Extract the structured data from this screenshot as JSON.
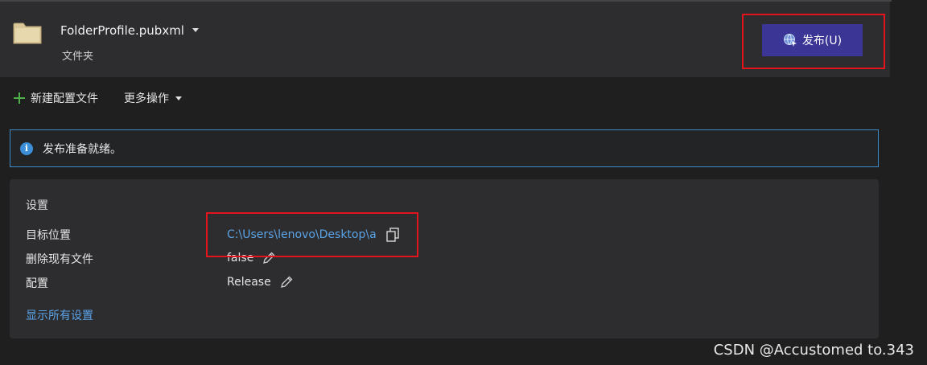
{
  "header": {
    "profile_name": "FolderProfile.pubxml",
    "profile_type": "文件夹",
    "publish_label": "发布(U)"
  },
  "toolbar": {
    "new_profile_label": "新建配置文件",
    "more_actions_label": "更多操作"
  },
  "info": {
    "message": "发布准备就绪。",
    "icon_glyph": "i"
  },
  "settings": {
    "title": "设置",
    "rows": [
      {
        "label": "目标位置",
        "value": "C:\\Users\\lenovo\\Desktop\\a"
      },
      {
        "label": "删除现有文件",
        "value": "false"
      },
      {
        "label": "配置",
        "value": "Release"
      }
    ],
    "show_all_label": "显示所有设置"
  },
  "watermark": "CSDN @Accustomed to.343",
  "colors": {
    "accent": "#3b3596",
    "link": "#5aa3e6",
    "highlight": "#e3141e",
    "info_border": "#3f8ccb",
    "add_icon": "#4fb04a"
  },
  "icons": [
    "folder-icon",
    "chevron-down-icon",
    "globe-publish-icon",
    "plus-icon",
    "info-icon",
    "copy-icon",
    "pencil-icon"
  ]
}
